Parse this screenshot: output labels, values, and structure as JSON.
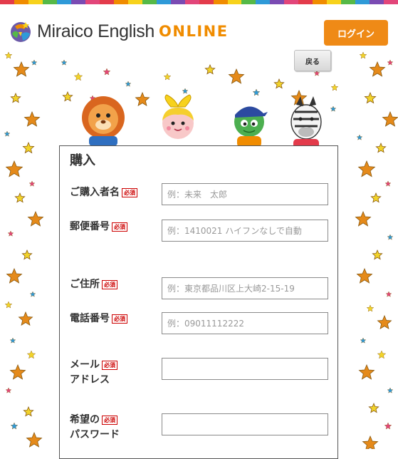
{
  "header": {
    "logo_text": "Miraico English",
    "logo_accent": "ONLINE",
    "login_label": "ログイン"
  },
  "back_label": "戻る",
  "form": {
    "title": "購入",
    "required_label": "必須",
    "fields": [
      {
        "label_line1": "ご購入者名",
        "label_line2": "",
        "placeholder": "例：未来　太郎",
        "value": ""
      },
      {
        "label_line1": "郵便番号",
        "label_line2": "",
        "placeholder": "例：1410021 ハイフンなしで自動",
        "value": ""
      },
      {
        "label_line1": "ご住所",
        "label_line2": "",
        "placeholder": "例：東京都品川区上大崎2-15-19",
        "value": ""
      },
      {
        "label_line1": "電話番号",
        "label_line2": "",
        "placeholder": "例：09011112222",
        "value": ""
      },
      {
        "label_line1": "メール",
        "label_line2": "アドレス",
        "placeholder": "",
        "value": ""
      },
      {
        "label_line1": "希望の",
        "label_line2": "パスワード",
        "placeholder": "",
        "value": ""
      }
    ]
  },
  "colors": {
    "accent": "#ef8a16",
    "required": "#cc0000",
    "star_orange": "#e58a1a",
    "star_yellow": "#f1d32a",
    "star_blue": "#2f9ad8",
    "star_pink": "#e2467a"
  },
  "icons": [
    "globe-logo-icon",
    "lion-character",
    "girl-character",
    "turtle-character",
    "zebra-character",
    "star-icon"
  ]
}
